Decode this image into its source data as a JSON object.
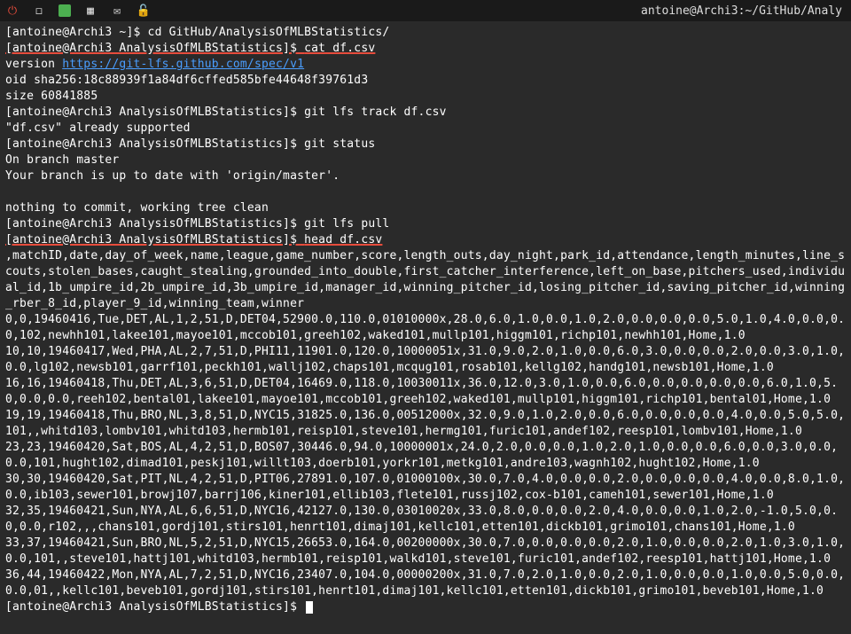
{
  "topbar": {
    "title": "antoine@Archi3:~/GitHub/Analy"
  },
  "terminal": {
    "line1_prompt": "[antoine@Archi3 ~]$ ",
    "line1_cmd": "cd GitHub/AnalysisOfMLBStatistics/",
    "line2_prompt": "[antoine@Archi3 AnalysisOfMLBStatistics]$ ",
    "line2_cmd": "cat df.csv",
    "line3_a": "version ",
    "line3_link": "https://git-lfs.github.com/spec/v1",
    "line4": "oid sha256:18c88939f1a84df6cffed585bfe44648f39761d3",
    "line5": "size 60841885",
    "line6_prompt": "[antoine@Archi3 AnalysisOfMLBStatistics]$ ",
    "line6_cmd": "git lfs track df.csv",
    "line7": "\"df.csv\" already supported",
    "line8_prompt": "[antoine@Archi3 AnalysisOfMLBStatistics]$ ",
    "line8_cmd": "git status",
    "line9": "On branch master",
    "line10": "Your branch is up to date with 'origin/master'.",
    "line11": "",
    "line12": "nothing to commit, working tree clean",
    "line13_prompt": "[antoine@Archi3 AnalysisOfMLBStatistics]$ ",
    "line13_cmd": "git lfs pull",
    "line14_prompt": "[antoine@Archi3 AnalysisOfMLBStatistics]$ ",
    "line14_cmd": "head df.csv",
    "csv_header": ",matchID,date,day_of_week,name,league,game_number,score,length_outs,day_night,park_id,attendance,length_minutes,line_scouts,stolen_bases,caught_stealing,grounded_into_double,first_catcher_interference,left_on_base,pitchers_used,individual_id,1b_umpire_id,2b_umpire_id,3b_umpire_id,manager_id,winning_pitcher_id,losing_pitcher_id,saving_pitcher_id,winning_rber_8_id,player_9_id,winning_team,winner",
    "csv_row1": "0,0,19460416,Tue,DET,AL,1,2,51,D,DET04,52900.0,110.0,01010000x,28.0,6.0,1.0,0.0,1.0,2.0,0.0,0.0,0.0,5.0,1.0,4.0,0.0,0.0,102,newhh101,lakee101,mayoe101,mccob101,greeh102,waked101,mullp101,higgm101,richp101,newhh101,Home,1.0",
    "csv_row2": "10,10,19460417,Wed,PHA,AL,2,7,51,D,PHI11,11901.0,120.0,10000051x,31.0,9.0,2.0,1.0,0.0,6.0,3.0,0.0,0.0,2.0,0.0,3.0,1.0,0.0,lg102,newsb101,garrf101,peckh101,wallj102,chaps101,mcqug101,rosab101,kellg102,handg101,newsb101,Home,1.0",
    "csv_row3": "16,16,19460418,Thu,DET,AL,3,6,51,D,DET04,16469.0,118.0,10030011x,36.0,12.0,3.0,1.0,0.0,6.0,0.0,0.0,0.0,0.0,6.0,1.0,5.0,0.0,0.0,reeh102,bental01,lakee101,mayoe101,mccob101,greeh102,waked101,mullp101,higgm101,richp101,bental01,Home,1.0",
    "csv_row4": "19,19,19460418,Thu,BRO,NL,3,8,51,D,NYC15,31825.0,136.0,00512000x,32.0,9.0,1.0,2.0,0.0,6.0,0.0,0.0,0.0,4.0,0.0,5.0,5.0,101,,whitd103,lombv101,whitd103,hermb101,reisp101,steve101,hermg101,furic101,andef102,reesp101,lombv101,Home,1.0",
    "csv_row5": "23,23,19460420,Sat,BOS,AL,4,2,51,D,BOS07,30446.0,94.0,10000001x,24.0,2.0,0.0,0.0,1.0,2.0,1.0,0.0,0.0,6.0,0.0,3.0,0.0,0.0,101,hught102,dimad101,peskj101,willt103,doerb101,yorkr101,metkg101,andre103,wagnh102,hught102,Home,1.0",
    "csv_row6": "30,30,19460420,Sat,PIT,NL,4,2,51,D,PIT06,27891.0,107.0,01000100x,30.0,7.0,4.0,0.0,0.0,2.0,0.0,0.0,0.0,4.0,0.0,8.0,1.0,0.0,ib103,sewer101,browj107,barrj106,kiner101,ellib103,flete101,russj102,cox-b101,cameh101,sewer101,Home,1.0",
    "csv_row7": "32,35,19460421,Sun,NYA,AL,6,6,51,D,NYC16,42127.0,130.0,03010020x,33.0,8.0,0.0,0.0,2.0,4.0,0.0,0.0,1.0,2.0,-1.0,5.0,0.0,0.0,r102,,,chans101,gordj101,stirs101,henrt101,dimaj101,kellc101,etten101,dickb101,grimo101,chans101,Home,1.0",
    "csv_row8": "33,37,19460421,Sun,BRO,NL,5,2,51,D,NYC15,26653.0,164.0,00200000x,30.0,7.0,0.0,0.0,0.0,2.0,1.0,0.0,0.0,2.0,1.0,3.0,1.0,0.0,101,,steve101,hattj101,whitd103,hermb101,reisp101,walkd101,steve101,furic101,andef102,reesp101,hattj101,Home,1.0",
    "csv_row9": "36,44,19460422,Mon,NYA,AL,7,2,51,D,NYC16,23407.0,104.0,00000200x,31.0,7.0,2.0,1.0,0.0,2.0,1.0,0.0,0.0,1.0,0.0,5.0,0.0,0.0,01,,kellc101,beveb101,gordj101,stirs101,henrt101,dimaj101,kellc101,etten101,dickb101,grimo101,beveb101,Home,1.0",
    "final_prompt": "[antoine@Archi3 AnalysisOfMLBStatistics]$ "
  }
}
